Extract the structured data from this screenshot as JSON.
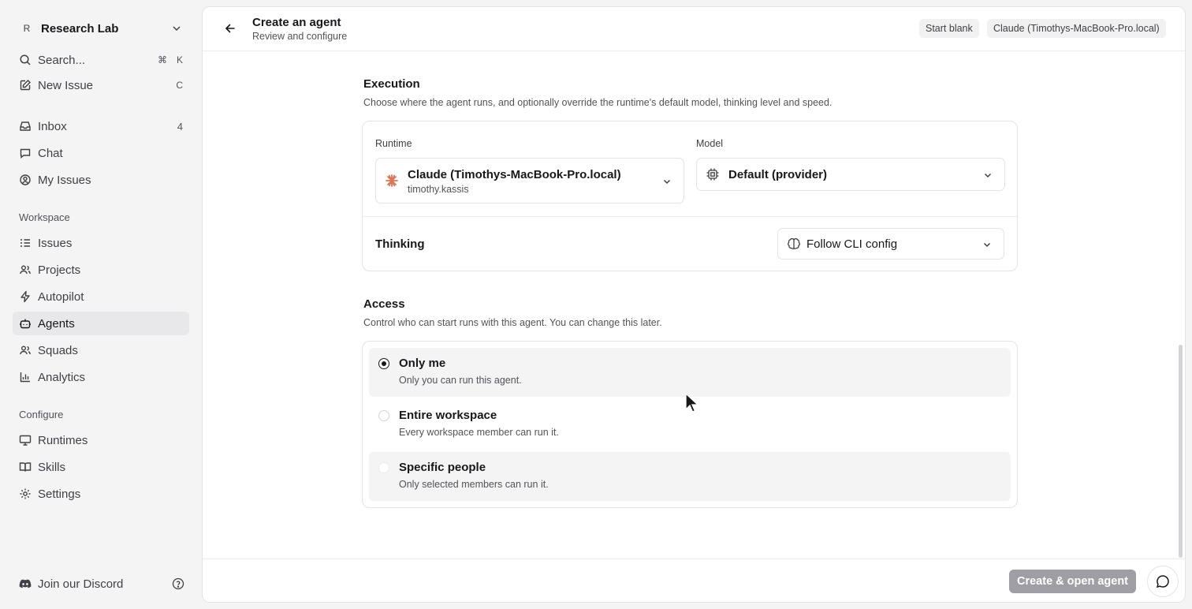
{
  "workspace": {
    "avatar": "R",
    "name": "Research Lab"
  },
  "sidebar": {
    "search": {
      "label": "Search...",
      "shortcut_mod": "⌘",
      "shortcut_key": "K"
    },
    "new_issue": {
      "label": "New Issue",
      "shortcut": "C"
    },
    "inbox": {
      "label": "Inbox",
      "count": "4"
    },
    "chat": {
      "label": "Chat"
    },
    "my_issues": {
      "label": "My Issues"
    },
    "workspace_label": "Workspace",
    "workspace_items": [
      "Issues",
      "Projects",
      "Autopilot",
      "Agents",
      "Squads",
      "Analytics"
    ],
    "configure_label": "Configure",
    "configure_items": [
      "Runtimes",
      "Skills",
      "Settings"
    ],
    "discord": "Join our Discord",
    "active_item": "Agents"
  },
  "header": {
    "title": "Create an agent",
    "subtitle": "Review and configure",
    "chip_blank": "Start blank",
    "chip_runtime": "Claude (Timothys-MacBook-Pro.local)"
  },
  "execution": {
    "title": "Execution",
    "description": "Choose where the agent runs, and optionally override the runtime's default model, thinking level and speed.",
    "runtime_label": "Runtime",
    "runtime_value": "Claude (Timothys-MacBook-Pro.local)",
    "runtime_user": "timothy.kassis",
    "model_label": "Model",
    "model_value": "Default (provider)",
    "thinking_label": "Thinking",
    "thinking_value": "Follow CLI config"
  },
  "access": {
    "title": "Access",
    "description": "Control who can start runs with this agent. You can change this later.",
    "options": [
      {
        "title": "Only me",
        "desc": "Only you can run this agent.",
        "checked": true
      },
      {
        "title": "Entire workspace",
        "desc": "Every workspace member can run it.",
        "checked": false
      },
      {
        "title": "Specific people",
        "desc": "Only selected members can run it.",
        "checked": false
      }
    ]
  },
  "footer": {
    "create_label": "Create & open agent"
  },
  "colors": {
    "accent_runtime": "#d97757",
    "button_disabled": "#9e9ea4"
  }
}
